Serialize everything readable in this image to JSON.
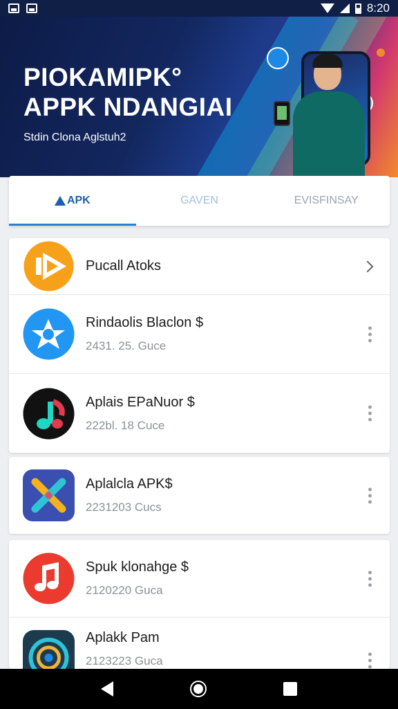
{
  "status_bar": {
    "time": "8:20"
  },
  "hero": {
    "title_line1": "PIOKAMIPK°",
    "title_line2": "APPK NDANGIAI",
    "subtitle": "Stdin Clona Aglstuh2"
  },
  "tabs": [
    {
      "label": "APK",
      "active": true
    },
    {
      "label": "GAVEN",
      "active": false
    },
    {
      "label": "EVISFINSAY",
      "active": false
    }
  ],
  "list_cards": [
    {
      "rows": [
        {
          "title": "Pucall Atoks",
          "subtitle": "",
          "icon": "play-icon",
          "icon_bg": "#f7a11a",
          "action": "chevron"
        },
        {
          "title": "Rindaolis Blaclon $",
          "subtitle": "2431. 25. Guce",
          "icon": "star-icon",
          "icon_bg": "#2196f3",
          "action": "more"
        },
        {
          "title": "Aplais EPaNuor $",
          "subtitle": "222bl. 18 Cuce",
          "icon": "music-note-icon",
          "icon_bg": "#111111",
          "action": "more"
        }
      ]
    },
    {
      "rows": [
        {
          "title": "Aplalcla APK$",
          "subtitle": "2231203 Cucs",
          "icon": "x-logo-icon",
          "icon_bg": "#3a4fb0",
          "action": "more"
        }
      ]
    },
    {
      "rows": [
        {
          "title": "Spuk klonahge $",
          "subtitle": "2120220 Guca",
          "icon": "music-note-icon",
          "icon_bg": "#ea3b2e",
          "action": "more"
        },
        {
          "title": "Aplakk Pam",
          "subtitle": "2123223 Guca",
          "icon": "target-icon",
          "icon_bg": "#1c3b4f",
          "action": "more"
        }
      ]
    }
  ]
}
